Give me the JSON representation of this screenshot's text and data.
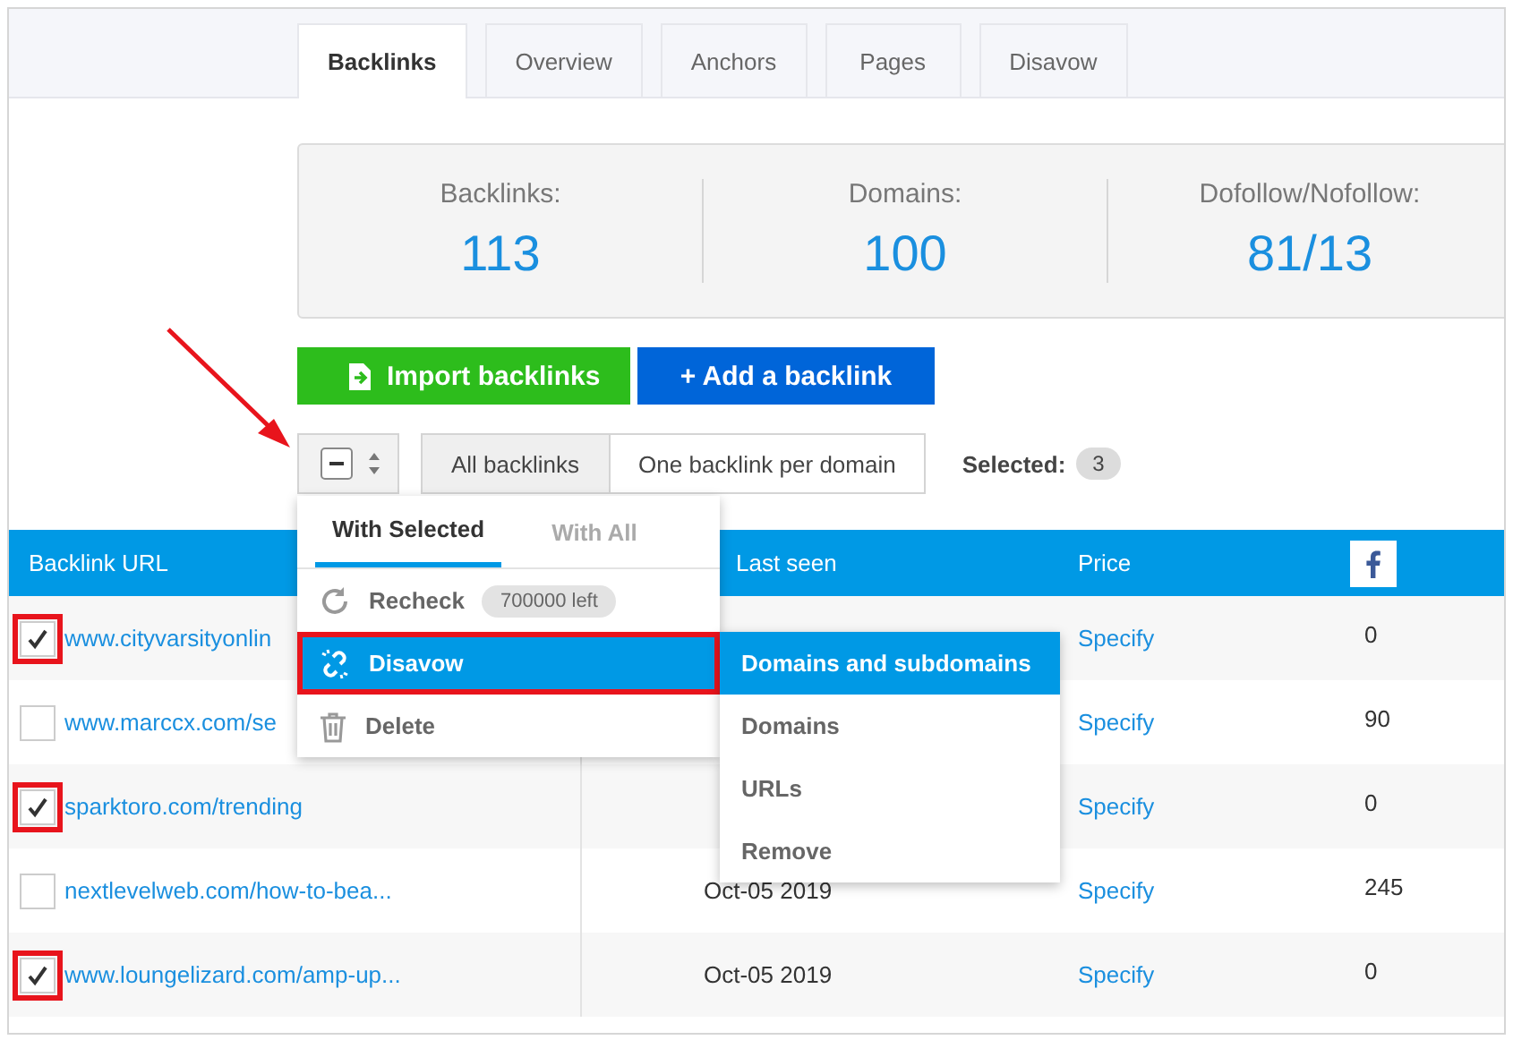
{
  "tabs": [
    {
      "label": "Backlinks",
      "selected": true
    },
    {
      "label": "Overview",
      "selected": false
    },
    {
      "label": "Anchors",
      "selected": false
    },
    {
      "label": "Pages",
      "selected": false
    },
    {
      "label": "Disavow",
      "selected": false
    }
  ],
  "stats": [
    {
      "label": "Backlinks:",
      "value": "113"
    },
    {
      "label": "Domains:",
      "value": "100"
    },
    {
      "label": "Dofollow/Nofollow:",
      "value": "81/13"
    }
  ],
  "buttons": [
    {
      "kind": "import",
      "label": "Import backlinks"
    },
    {
      "kind": "add",
      "label": "+ Add a backlink"
    }
  ],
  "filters": [
    {
      "label": "All backlinks",
      "selected": true
    },
    {
      "label": "One backlink per domain",
      "selected": false
    }
  ],
  "selected_label": "Selected:",
  "selected_count": "3",
  "table": {
    "columns": [
      {
        "kind": "text",
        "label": "Backlink URL"
      },
      {
        "kind": "text",
        "label": "Last seen"
      },
      {
        "kind": "text",
        "label": "Price"
      },
      {
        "kind": "facebook"
      }
    ],
    "rows": [
      {
        "checked": true,
        "url": "www.cityvarsityonlin",
        "price": "Specify",
        "facebook": "0"
      },
      {
        "checked": false,
        "url": "www.marccx.com/se",
        "price": "Specify",
        "facebook": "90"
      },
      {
        "checked": true,
        "url": "sparktoro.com/trending",
        "price": "Specify",
        "facebook": "0"
      },
      {
        "checked": false,
        "url": "nextlevelweb.com/how-to-bea...",
        "last_seen": "Oct-05 2019",
        "price": "Specify",
        "facebook": "245"
      },
      {
        "checked": true,
        "url": "www.loungelizard.com/amp-up...",
        "last_seen": "Oct-05 2019",
        "price": "Specify",
        "facebook": "0"
      }
    ]
  },
  "menu": {
    "tabs": [
      {
        "label": "With Selected",
        "selected": true
      },
      {
        "label": "With All",
        "selected": false
      }
    ],
    "items": [
      {
        "kind": "recheck",
        "label": "Recheck",
        "badge": "700000 left",
        "selected": false
      },
      {
        "kind": "disavow",
        "label": "Disavow",
        "selected": true
      },
      {
        "kind": "delete",
        "label": "Delete",
        "selected": false
      }
    ]
  },
  "submenu": [
    {
      "label": "Domains and subdomains",
      "selected": true
    },
    {
      "label": "Domains",
      "selected": false
    },
    {
      "label": "URLs",
      "selected": false
    },
    {
      "label": "Remove",
      "selected": false
    }
  ]
}
